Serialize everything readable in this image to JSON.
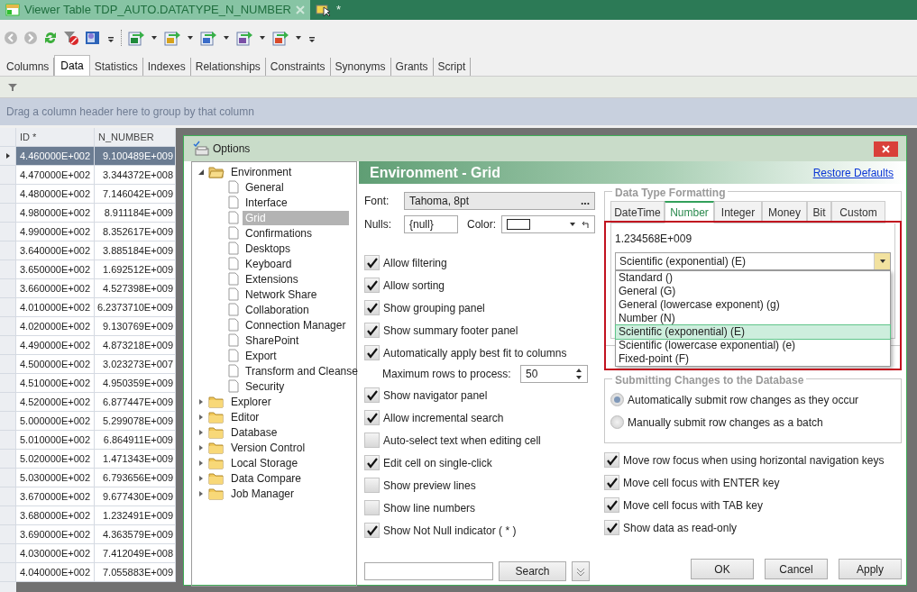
{
  "document_tabs": [
    {
      "label": "Viewer Table TDP_AUTO.DATATYPE_N_NUMBER",
      "selected": true
    },
    {
      "label": "*",
      "selected": false
    }
  ],
  "object_tabs": [
    {
      "label": "Columns",
      "selected": false
    },
    {
      "label": "Data",
      "selected": true
    },
    {
      "label": "Statistics",
      "selected": false
    },
    {
      "label": "Indexes",
      "selected": false
    },
    {
      "label": "Relationships",
      "selected": false
    },
    {
      "label": "Constraints",
      "selected": false
    },
    {
      "label": "Synonyms",
      "selected": false
    },
    {
      "label": "Grants",
      "selected": false
    },
    {
      "label": "Script",
      "selected": false
    }
  ],
  "group_hint": "Drag a column header here to group by that column",
  "grid": {
    "columns": [
      "ID *",
      "N_NUMBER"
    ],
    "rows": [
      {
        "cells": [
          "4.460000E+002",
          "9.100489E+009"
        ],
        "selected": true
      },
      {
        "cells": [
          "4.470000E+002",
          "3.344372E+008"
        ],
        "selected": false
      },
      {
        "cells": [
          "4.480000E+002",
          "7.146042E+009"
        ],
        "selected": false
      },
      {
        "cells": [
          "4.980000E+002",
          "8.911184E+009"
        ],
        "selected": false
      },
      {
        "cells": [
          "4.990000E+002",
          "8.352617E+009"
        ],
        "selected": false
      },
      {
        "cells": [
          "3.640000E+002",
          "3.885184E+009"
        ],
        "selected": false
      },
      {
        "cells": [
          "3.650000E+002",
          "1.692512E+009"
        ],
        "selected": false
      },
      {
        "cells": [
          "3.660000E+002",
          "4.527398E+009"
        ],
        "selected": false
      },
      {
        "cells": [
          "4.010000E+002",
          "6.2373710E+009"
        ],
        "selected": false
      },
      {
        "cells": [
          "4.020000E+002",
          "9.130769E+009"
        ],
        "selected": false
      },
      {
        "cells": [
          "4.490000E+002",
          "4.873218E+009"
        ],
        "selected": false
      },
      {
        "cells": [
          "4.500000E+002",
          "3.023273E+007"
        ],
        "selected": false
      },
      {
        "cells": [
          "4.510000E+002",
          "4.950359E+009"
        ],
        "selected": false
      },
      {
        "cells": [
          "4.520000E+002",
          "6.877447E+009"
        ],
        "selected": false
      },
      {
        "cells": [
          "5.000000E+002",
          "5.299078E+009"
        ],
        "selected": false
      },
      {
        "cells": [
          "5.010000E+002",
          "6.864911E+009"
        ],
        "selected": false
      },
      {
        "cells": [
          "5.020000E+002",
          "1.471343E+009"
        ],
        "selected": false
      },
      {
        "cells": [
          "5.030000E+002",
          "6.793656E+009"
        ],
        "selected": false
      },
      {
        "cells": [
          "3.670000E+002",
          "9.677430E+009"
        ],
        "selected": false
      },
      {
        "cells": [
          "3.680000E+002",
          "1.232491E+009"
        ],
        "selected": false
      },
      {
        "cells": [
          "3.690000E+002",
          "4.363579E+009"
        ],
        "selected": false
      },
      {
        "cells": [
          "4.030000E+002",
          "7.412049E+008"
        ],
        "selected": false
      },
      {
        "cells": [
          "4.040000E+002",
          "7.055883E+009"
        ],
        "selected": false
      }
    ]
  },
  "dialog": {
    "title": "Options",
    "tree": [
      {
        "label": "Environment",
        "expanded": true,
        "selected": false,
        "children": [
          {
            "label": "General",
            "selected": false
          },
          {
            "label": "Interface",
            "selected": false
          },
          {
            "label": "Grid",
            "selected": true
          },
          {
            "label": "Confirmations",
            "selected": false
          },
          {
            "label": "Desktops",
            "selected": false
          },
          {
            "label": "Keyboard",
            "selected": false
          },
          {
            "label": "Extensions",
            "selected": false
          },
          {
            "label": "Network Share",
            "selected": false
          },
          {
            "label": "Collaboration",
            "selected": false
          },
          {
            "label": "Connection Manager",
            "selected": false
          },
          {
            "label": "SharePoint",
            "selected": false
          },
          {
            "label": "Export",
            "selected": false
          },
          {
            "label": "Transform and Cleanse",
            "selected": false
          },
          {
            "label": "Security",
            "selected": false
          }
        ]
      },
      {
        "label": "Explorer",
        "expanded": false,
        "selected": false
      },
      {
        "label": "Editor",
        "expanded": false,
        "selected": false
      },
      {
        "label": "Database",
        "expanded": false,
        "selected": false
      },
      {
        "label": "Version Control",
        "expanded": false,
        "selected": false
      },
      {
        "label": "Local Storage",
        "expanded": false,
        "selected": false
      },
      {
        "label": "Data Compare",
        "expanded": false,
        "selected": false
      },
      {
        "label": "Job Manager",
        "expanded": false,
        "selected": false
      }
    ],
    "page_title": "Environment - Grid",
    "restore_link": "Restore Defaults",
    "font_label": "Font:",
    "font_value": "Tahoma, 8pt",
    "font_button": "...",
    "nulls_label": "Nulls:",
    "nulls_value": "{null}",
    "color_label": "Color:",
    "options": [
      {
        "kind": "checkbox",
        "label": "Allow filtering",
        "checked": true
      },
      {
        "kind": "checkbox",
        "label": "Allow sorting",
        "checked": true
      },
      {
        "kind": "checkbox",
        "label": "Show grouping panel",
        "checked": true
      },
      {
        "kind": "checkbox",
        "label": "Show summary footer panel",
        "checked": true
      },
      {
        "kind": "checkbox",
        "label": "Automatically apply best fit to columns",
        "checked": true
      },
      {
        "kind": "number",
        "label": "Maximum rows to process:",
        "value": "50"
      },
      {
        "kind": "checkbox",
        "label": "Show navigator panel",
        "checked": true
      },
      {
        "kind": "checkbox",
        "label": "Allow incremental search",
        "checked": true
      },
      {
        "kind": "checkbox",
        "label": "Auto-select text when editing cell",
        "checked": false
      },
      {
        "kind": "checkbox",
        "label": "Edit cell on single-click",
        "checked": true
      },
      {
        "kind": "checkbox",
        "label": "Show preview lines",
        "checked": false
      },
      {
        "kind": "checkbox",
        "label": "Show line numbers",
        "checked": false
      },
      {
        "kind": "checkbox",
        "label": "Show Not Null indicator ( * )",
        "checked": true
      }
    ],
    "search_button": "Search",
    "formatting": {
      "title": "Data Type Formatting",
      "tabs": [
        {
          "label": "DateTime",
          "selected": false
        },
        {
          "label": "Number",
          "selected": true
        },
        {
          "label": "Integer",
          "selected": false
        },
        {
          "label": "Money",
          "selected": false
        },
        {
          "label": "Bit",
          "selected": false
        },
        {
          "label": "Custom",
          "selected": false
        }
      ],
      "preview": "1.234568E+009",
      "format_value": "Scientific (exponential) (E)",
      "format_options": [
        {
          "label": "Standard ()",
          "selected": false
        },
        {
          "label": "General (G)",
          "selected": false
        },
        {
          "label": "General (lowercase exponent) (g)",
          "selected": false
        },
        {
          "label": "Number (N)",
          "selected": false
        },
        {
          "label": "Scientific (exponential) (E)",
          "selected": true
        },
        {
          "label": "Scientific (lowercase exponential) (e)",
          "selected": false
        },
        {
          "label": "Fixed-point (F)",
          "selected": false
        }
      ]
    },
    "submitting": {
      "title": "Submitting Changes to the Database",
      "choices": [
        {
          "label": "Automatically submit row changes as they occur",
          "selected": true
        },
        {
          "label": "Manually submit row changes as a batch",
          "selected": false
        }
      ]
    },
    "right_options": [
      {
        "label": "Move row focus when using horizontal navigation keys",
        "checked": true
      },
      {
        "label": "Move cell focus with ENTER key",
        "checked": true
      },
      {
        "label": "Move cell focus with TAB key",
        "checked": true
      },
      {
        "label": "Show data as read-only",
        "checked": true
      }
    ],
    "buttons": [
      "OK",
      "Cancel",
      "Apply"
    ]
  }
}
